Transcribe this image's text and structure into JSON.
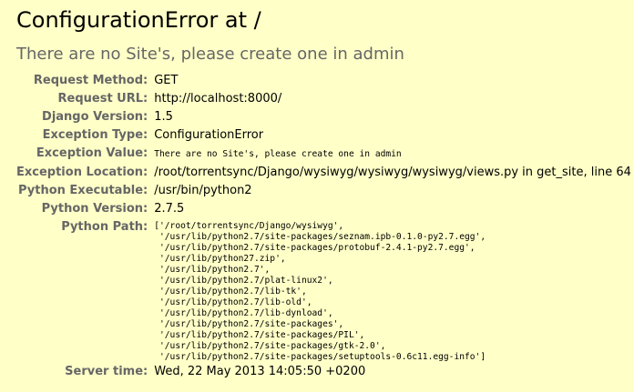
{
  "title": "ConfigurationError at /",
  "subtitle": "There are no Site's, please create one in admin",
  "meta": [
    {
      "label": "Request Method:",
      "value": "GET"
    },
    {
      "label": "Request URL:",
      "value": "http://localhost:8000/"
    },
    {
      "label": "Django Version:",
      "value": "1.5"
    },
    {
      "label": "Exception Type:",
      "value": "ConfigurationError"
    },
    {
      "label": "Exception Value:",
      "value": "There are no Site's, please create one in admin"
    },
    {
      "label": "Exception Location:",
      "value": "/root/torrentsync/Django/wysiwyg/wysiwyg/wysiwyg/views.py in get_site, line 64"
    },
    {
      "label": "Python Executable:",
      "value": "/usr/bin/python2"
    },
    {
      "label": "Python Version:",
      "value": "2.7.5"
    },
    {
      "label": "Python Path:",
      "value": "['/root/torrentsync/Django/wysiwyg',\n '/usr/lib/python2.7/site-packages/seznam.ipb-0.1.0-py2.7.egg',\n '/usr/lib/python2.7/site-packages/protobuf-2.4.1-py2.7.egg',\n '/usr/lib/python27.zip',\n '/usr/lib/python2.7',\n '/usr/lib/python2.7/plat-linux2',\n '/usr/lib/python2.7/lib-tk',\n '/usr/lib/python2.7/lib-old',\n '/usr/lib/python2.7/lib-dynload',\n '/usr/lib/python2.7/site-packages',\n '/usr/lib/python2.7/site-packages/PIL',\n '/usr/lib/python2.7/site-packages/gtk-2.0',\n '/usr/lib/python2.7/site-packages/setuptools-0.6c11.egg-info']"
    },
    {
      "label": "Server time:",
      "value": "Wed, 22 May 2013 14:05:50 +0200"
    }
  ],
  "colors": {
    "background": "#ffffc8",
    "label": "#666666",
    "subtitle": "#666666",
    "text": "#000000"
  }
}
